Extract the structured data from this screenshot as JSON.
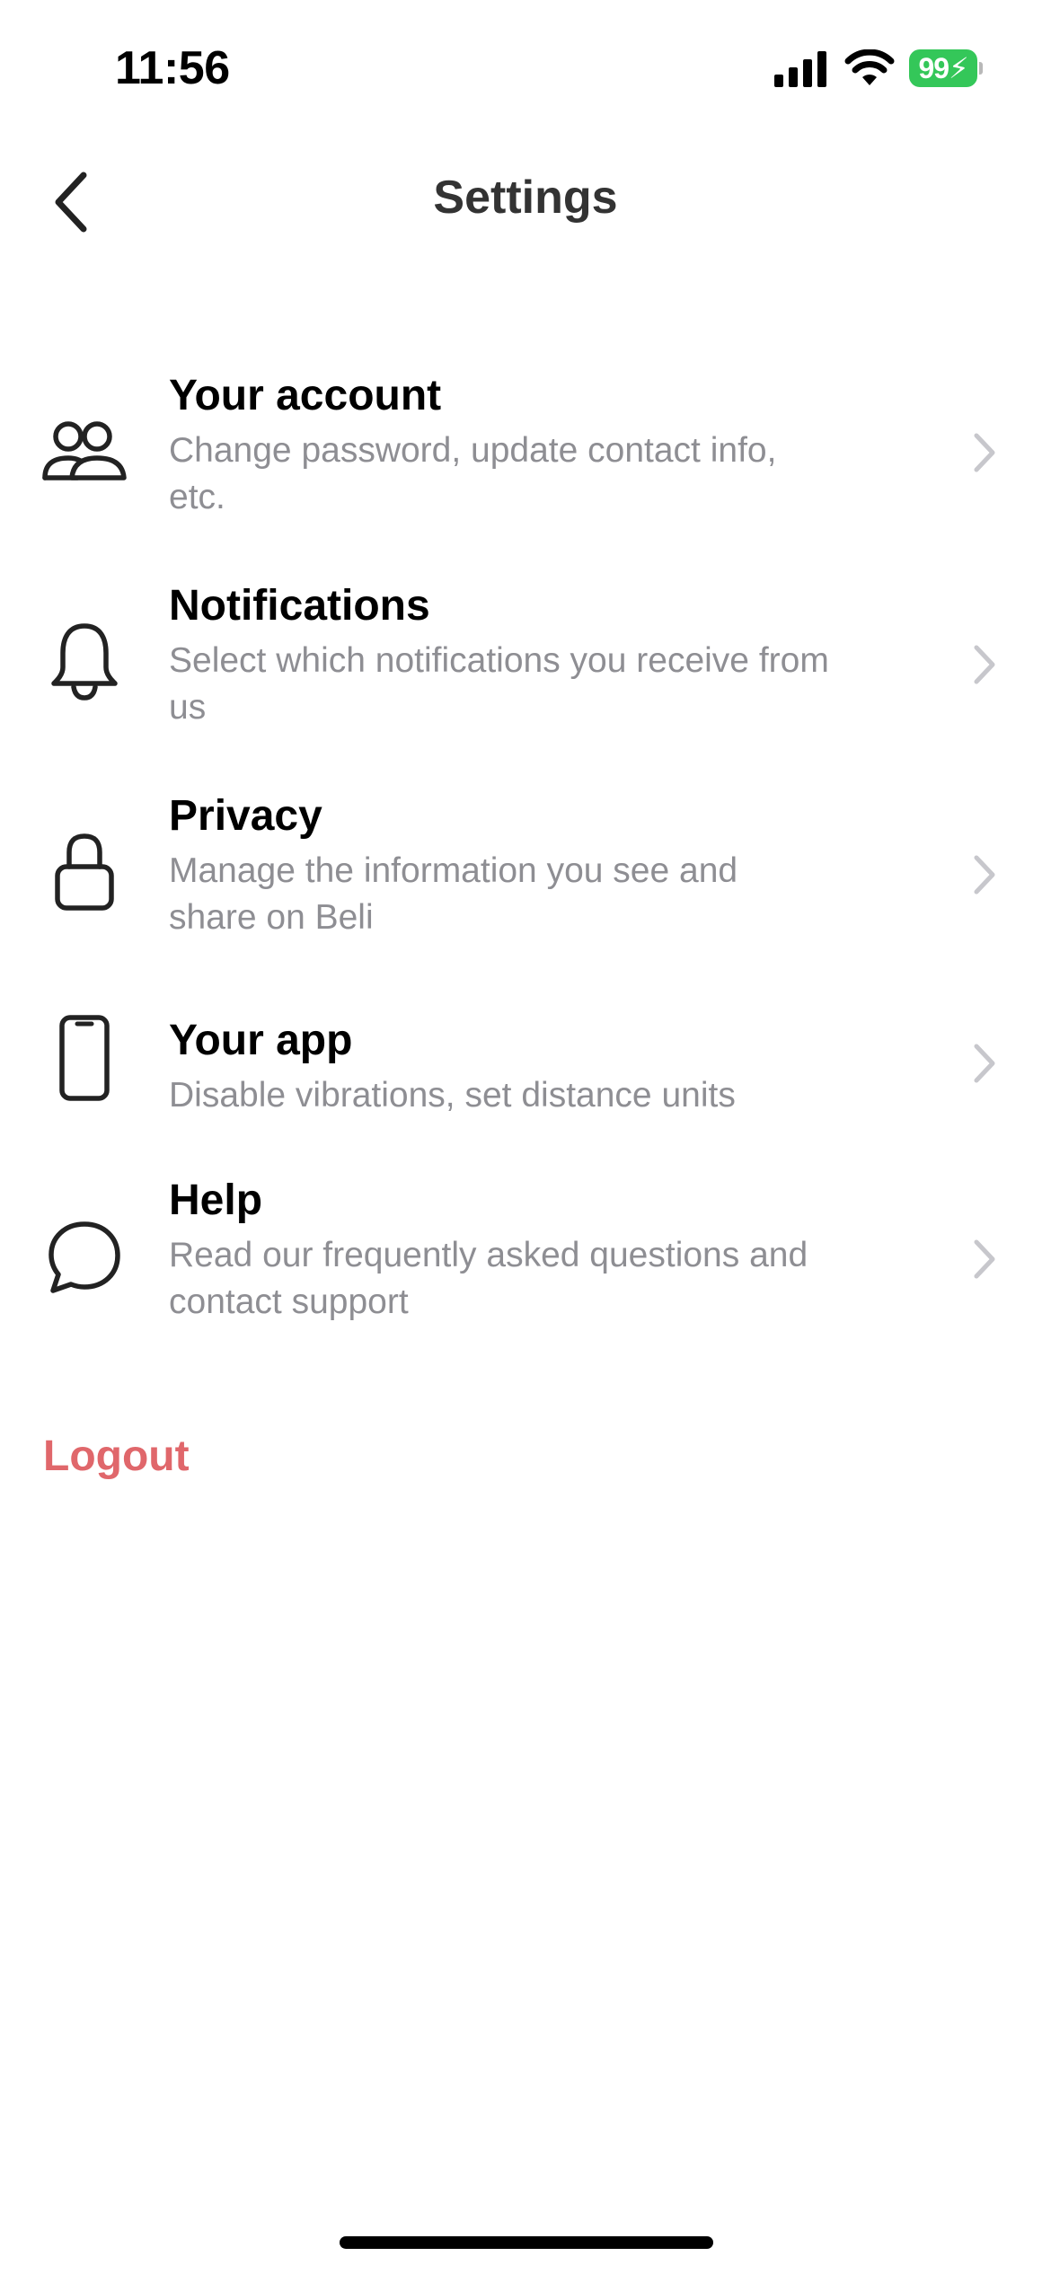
{
  "status_bar": {
    "time": "11:56",
    "battery_level": "99",
    "battery_charging": true,
    "battery_color": "#34c759",
    "signal_icon": "cellular-signal-icon",
    "wifi_icon": "wifi-icon"
  },
  "header": {
    "title": "Settings",
    "back_icon": "chevron-left-icon"
  },
  "settings": {
    "items": [
      {
        "title": "Your account",
        "subtitle": "Change password, update contact info, etc.",
        "icon": "people-icon"
      },
      {
        "title": "Notifications",
        "subtitle": "Select which notifications you receive from us",
        "icon": "bell-icon"
      },
      {
        "title": "Privacy",
        "subtitle": "Manage the information you see and share on Beli",
        "icon": "lock-icon"
      },
      {
        "title": "Your app",
        "subtitle": "Disable vibrations, set distance units",
        "icon": "phone-icon"
      },
      {
        "title": "Help",
        "subtitle": "Read our frequently asked questions and contact support",
        "icon": "chat-bubble-icon"
      }
    ],
    "chevron_icon": "chevron-right-icon"
  },
  "logout": {
    "label": "Logout",
    "color": "#e0676b"
  },
  "colors": {
    "title_text": "#000000",
    "subtitle_text": "#8e8e93",
    "header_text": "#333333",
    "chevron": "#c7c7cc"
  }
}
